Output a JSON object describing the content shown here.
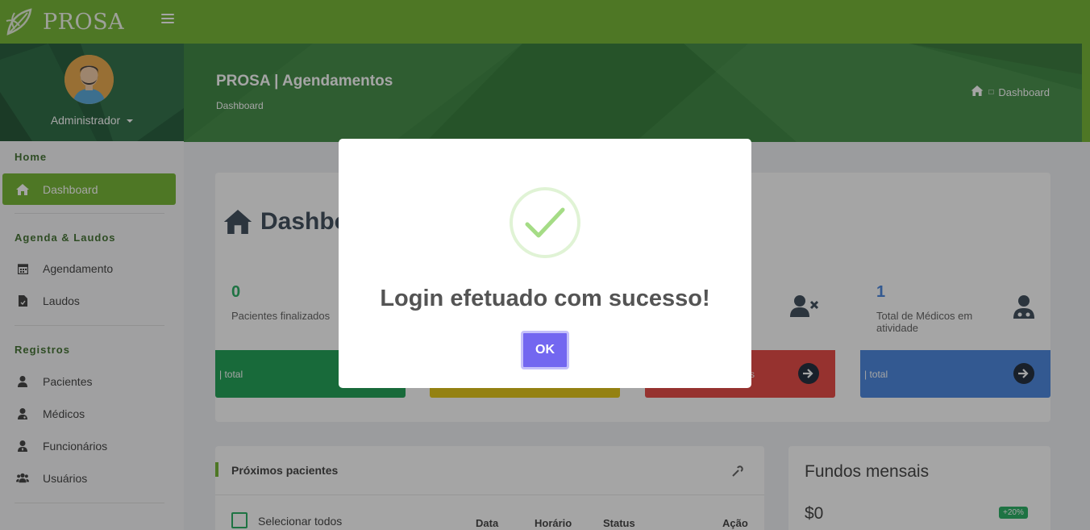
{
  "brand": {
    "name": "PROSA"
  },
  "user": {
    "name": "Administrador"
  },
  "sidebar": {
    "sections": [
      {
        "title": "Home"
      },
      {
        "title": "Agenda & Laudos"
      },
      {
        "title": "Registros"
      }
    ],
    "items": [
      {
        "label": "Dashboard",
        "icon": "home-icon"
      },
      {
        "label": "Agendamento",
        "icon": "calendar-icon"
      },
      {
        "label": "Laudos",
        "icon": "file-icon"
      },
      {
        "label": "Pacientes",
        "icon": "user-icon"
      },
      {
        "label": "Médicos",
        "icon": "doctor-icon"
      },
      {
        "label": "Funcionários",
        "icon": "user-tie-icon"
      },
      {
        "label": "Usuários",
        "icon": "users-icon"
      }
    ]
  },
  "header": {
    "title": "PROSA | Agendamentos",
    "subtitle": "Dashboard",
    "breadcrumb": "Dashboard"
  },
  "dashboard": {
    "title": "Dashbo",
    "cards": [
      {
        "value": "0",
        "label": "Pacientes finalizados",
        "footer": "| total",
        "color": "#0d9a48",
        "value_color": "#18a957"
      },
      {
        "value": "",
        "label": "",
        "footer": "",
        "color": "#e2c103",
        "value_color": "#333"
      },
      {
        "value": "",
        "label": "",
        "footer": "s",
        "color": "#e53935",
        "value_color": "#333"
      },
      {
        "value": "1",
        "label": "Total de Médicos em atividade",
        "footer": "| total",
        "color": "#3b7ddd",
        "value_color": "#3b7ddd"
      }
    ]
  },
  "next_patients": {
    "title": "Próximos pacientes",
    "select_all": "Selecionar todos",
    "columns": [
      "Data",
      "Horário",
      "Status",
      "Ação"
    ]
  },
  "funds": {
    "title": "Fundos mensais",
    "value": "$0",
    "badge": "+20%"
  },
  "modal": {
    "message": "Login efetuado com sucesso!",
    "ok_label": "OK"
  },
  "colors": {
    "brand_green": "#6ab023",
    "header_dark": "#2e7d32",
    "modal_button": "#7367f0"
  }
}
